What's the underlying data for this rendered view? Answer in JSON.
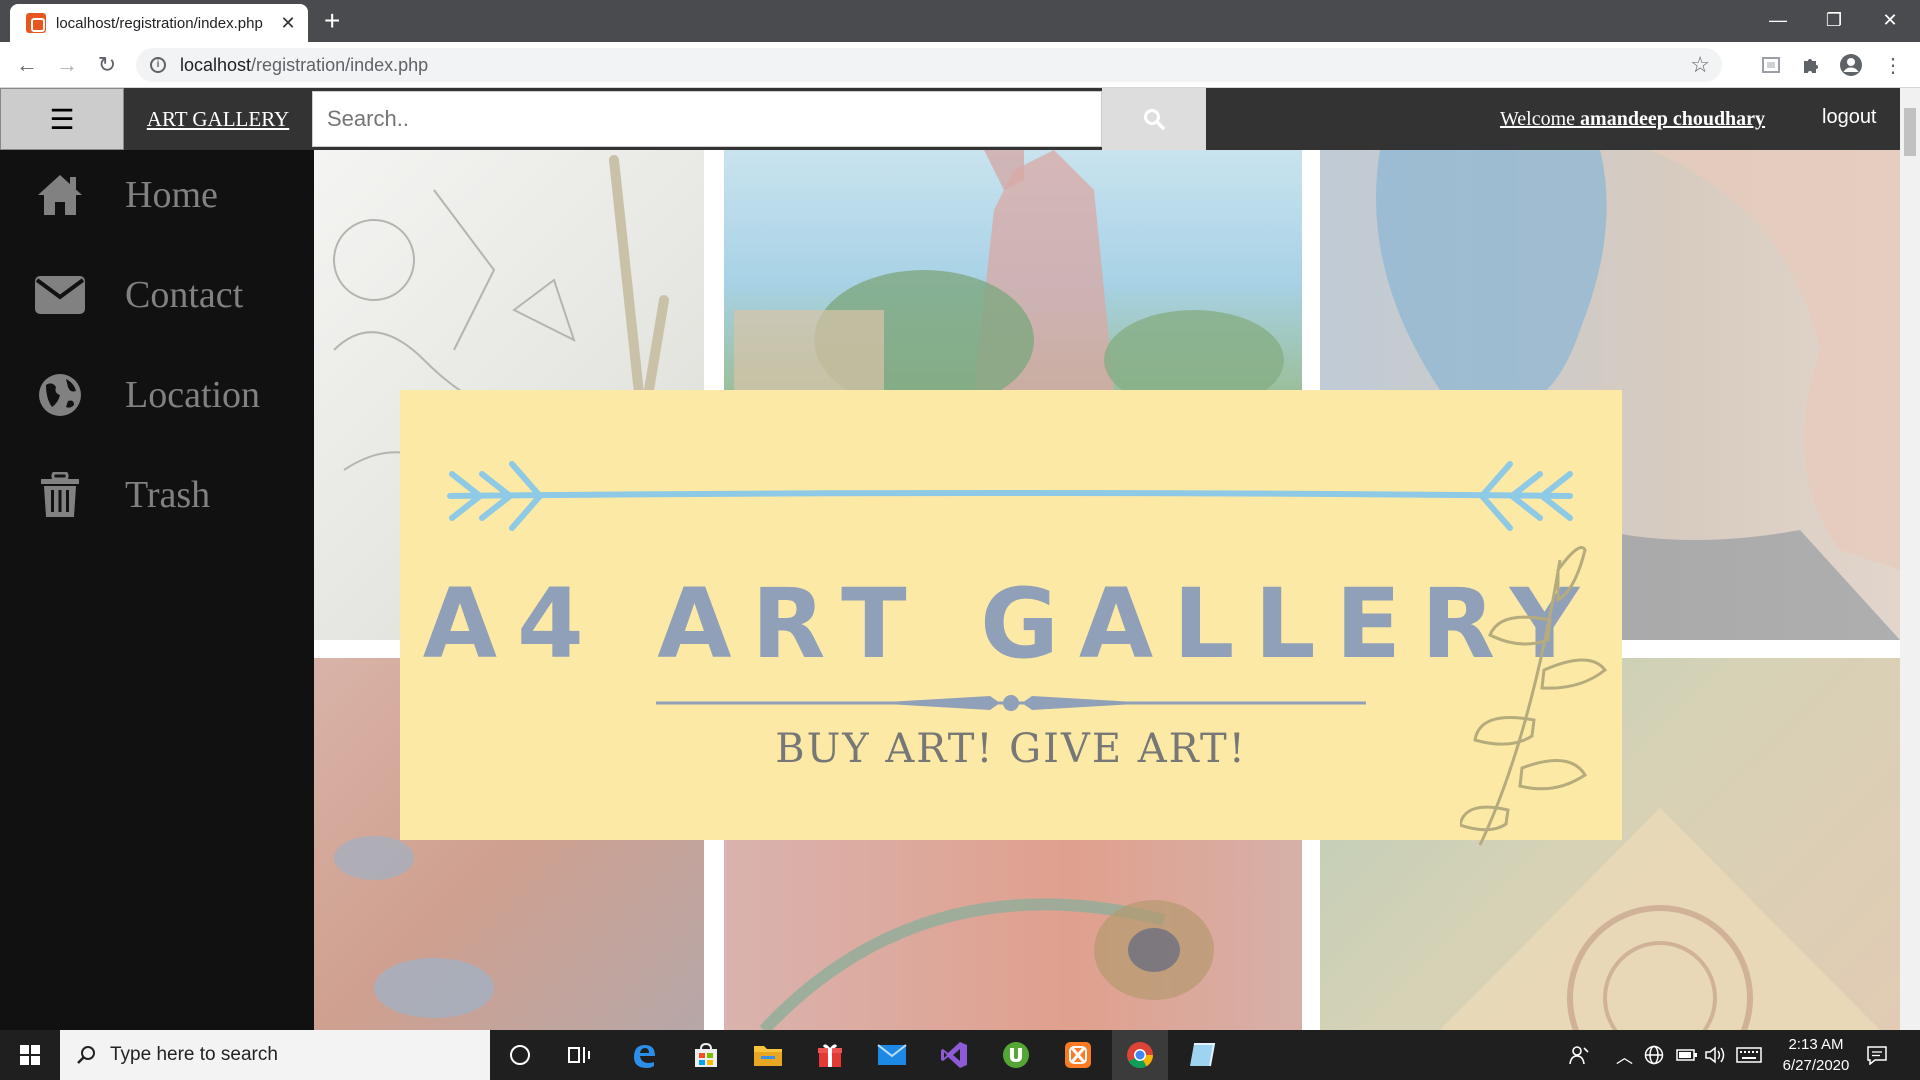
{
  "browser": {
    "tab_title": "localhost/registration/index.php",
    "url_host": "localhost",
    "url_path": "/registration/index.php",
    "new_tab": "+",
    "tab_close": "✕"
  },
  "nav": {
    "menu_icon": "☰",
    "brand": "ART GALLERY",
    "search_placeholder": "Search..",
    "welcome_prefix": "Welcome ",
    "welcome_user": "amandeep choudhary",
    "logout": "logout"
  },
  "sidebar": {
    "items": [
      {
        "label": "Home",
        "icon": "home-icon"
      },
      {
        "label": "Contact",
        "icon": "envelope-icon"
      },
      {
        "label": "Location",
        "icon": "globe-icon"
      },
      {
        "label": "Trash",
        "icon": "trash-icon"
      }
    ]
  },
  "banner": {
    "title": "A4 ART GALLERY",
    "subtitle": "BUY ART! GIVE ART!"
  },
  "taskbar": {
    "search_placeholder": "Type here to search",
    "time": "2:13 AM",
    "date": "6/27/2020"
  },
  "colors": {
    "nav_bg": "#333333",
    "sidebar_bg": "#111111",
    "sidebar_text": "#818181",
    "banner_bg": "#fde9a6",
    "banner_title": "#8fa0b8",
    "arrow_blue": "#8ecae6"
  }
}
